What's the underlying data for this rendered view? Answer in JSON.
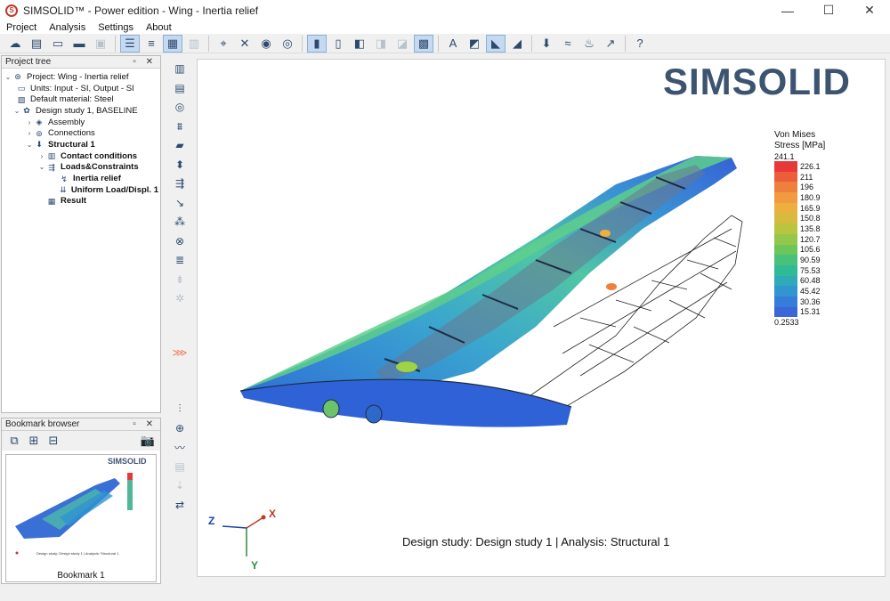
{
  "window": {
    "title": "SIMSOLID™ -  Power edition  -  Wing - Inertia relief",
    "minimize": "—",
    "maximize": "☐",
    "close": "✕"
  },
  "menu": [
    "Project",
    "Analysis",
    "Settings",
    "About"
  ],
  "project_tree": {
    "header": "Project tree",
    "items": [
      {
        "label": "Project: Wing - Inertia relief",
        "icon": "project-icon",
        "bold": false
      },
      {
        "label": "Units: Input - SI, Output - SI",
        "icon": "units-icon",
        "bold": false
      },
      {
        "label": "Default material: Steel",
        "icon": "material-icon",
        "bold": false
      },
      {
        "label": "Design study 1, BASELINE",
        "icon": "design-study-icon",
        "bold": false
      },
      {
        "label": "Assembly",
        "icon": "assembly-icon",
        "bold": false
      },
      {
        "label": "Connections",
        "icon": "connections-icon",
        "bold": false
      },
      {
        "label": "Structural  1",
        "icon": "structural-icon",
        "bold": true
      },
      {
        "label": "Contact conditions",
        "icon": "contact-icon",
        "bold": true
      },
      {
        "label": "Loads&Constraints",
        "icon": "loads-icon",
        "bold": true
      },
      {
        "label": "Inertia relief",
        "icon": "inertia-icon",
        "bold": true
      },
      {
        "label": "Uniform Load/Displ. 1",
        "icon": "uniform-load-icon",
        "bold": true
      },
      {
        "label": "Result",
        "icon": "result-icon",
        "bold": true
      }
    ]
  },
  "bookmark_browser": {
    "header": "Bookmark browser",
    "bookmark_label": "Bookmark 1",
    "thumb_logo": "SIMSOLID",
    "thumb_caption": "Design study: Design study 1 | Analysis: Structural 1"
  },
  "viewport": {
    "logo": "SIMSOLID",
    "caption": "Design study: Design study 1 | Analysis: Structural  1",
    "triad": {
      "x": "X",
      "y": "Y",
      "z": "Z"
    }
  },
  "legend": {
    "title_line1": "Von Mises",
    "title_line2": "Stress [MPa]",
    "max": "241.1",
    "levels": [
      {
        "value": "226.1",
        "color": "#e8393a"
      },
      {
        "value": "211",
        "color": "#ec5e3a"
      },
      {
        "value": "196",
        "color": "#ef7f3c"
      },
      {
        "value": "180.9",
        "color": "#f19a3f"
      },
      {
        "value": "165.9",
        "color": "#edaf40"
      },
      {
        "value": "150.8",
        "color": "#d7bb3e"
      },
      {
        "value": "135.8",
        "color": "#b9c53e"
      },
      {
        "value": "120.7",
        "color": "#93c84a"
      },
      {
        "value": "105.6",
        "color": "#6cc65a"
      },
      {
        "value": "90.59",
        "color": "#48c27a"
      },
      {
        "value": "75.53",
        "color": "#30bb97"
      },
      {
        "value": "60.48",
        "color": "#2eaab8"
      },
      {
        "value": "45.42",
        "color": "#3195cf"
      },
      {
        "value": "30.36",
        "color": "#357dd8"
      },
      {
        "value": "15.31",
        "color": "#3a66d8"
      }
    ],
    "min": "0.2533"
  }
}
